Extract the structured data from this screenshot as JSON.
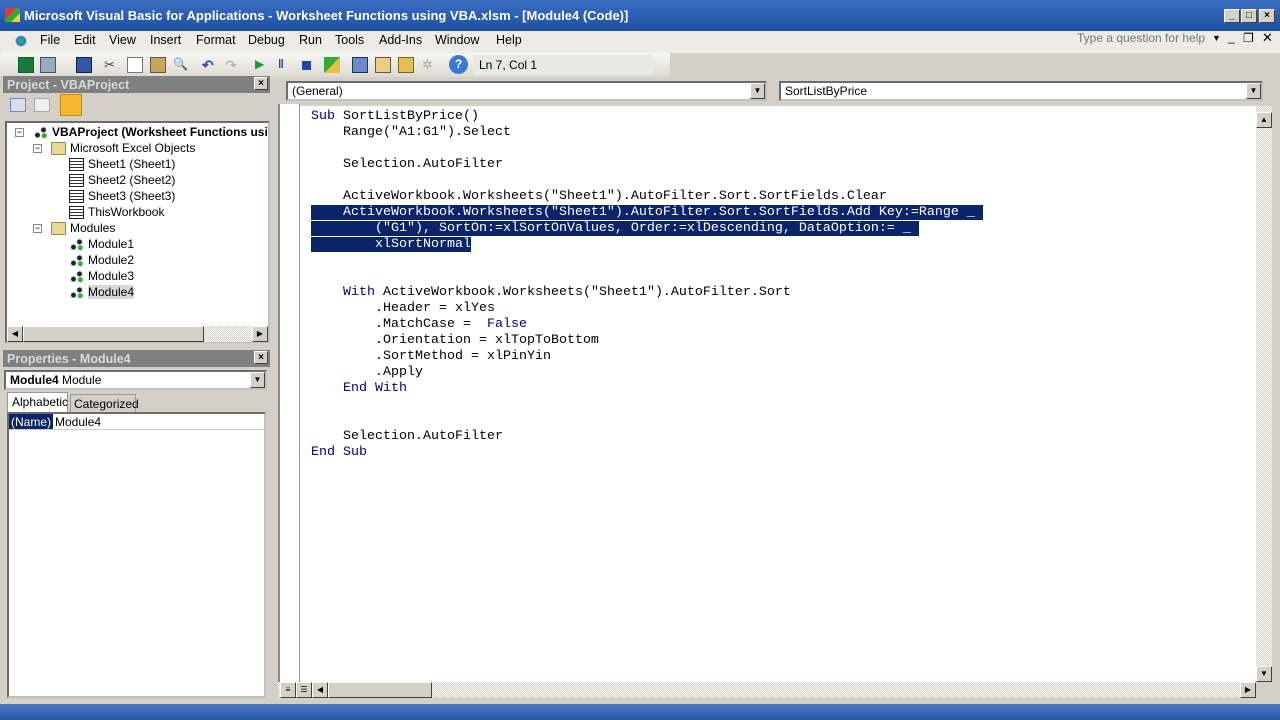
{
  "window": {
    "title": "Microsoft Visual Basic for Applications - Worksheet Functions using VBA.xlsm - [Module4 (Code)]"
  },
  "menu": [
    "File",
    "Edit",
    "View",
    "Insert",
    "Format",
    "Debug",
    "Run",
    "Tools",
    "Add-Ins",
    "Window",
    "Help"
  ],
  "help_placeholder": "Type a question for help",
  "toolbar": {
    "position": "Ln 7, Col 1",
    "icons": [
      "excel-icon",
      "insert-userform-icon",
      "save-icon",
      "cut-icon",
      "copy-icon",
      "paste-icon",
      "find-icon",
      "undo-icon",
      "redo-icon",
      "run-icon",
      "break-icon",
      "reset-icon",
      "design-mode-icon",
      "project-explorer-icon",
      "properties-icon",
      "object-browser-icon",
      "toolbox-icon",
      "help-icon"
    ]
  },
  "project": {
    "title": "Project - VBAProject",
    "tree": [
      {
        "label": "VBAProject (Worksheet Functions using VBA.xlsm)",
        "level": 0,
        "icon": "vba-project-icon",
        "bold": true
      },
      {
        "label": "Microsoft Excel Objects",
        "level": 1,
        "icon": "folder-icon"
      },
      {
        "label": "Sheet1 (Sheet1)",
        "level": 2,
        "icon": "sheet-icon"
      },
      {
        "label": "Sheet2 (Sheet2)",
        "level": 2,
        "icon": "sheet-icon"
      },
      {
        "label": "Sheet3 (Sheet3)",
        "level": 2,
        "icon": "sheet-icon"
      },
      {
        "label": "ThisWorkbook",
        "level": 2,
        "icon": "workbook-icon"
      },
      {
        "label": "Modules",
        "level": 1,
        "icon": "folder-icon"
      },
      {
        "label": "Module1",
        "level": 2,
        "icon": "module-icon"
      },
      {
        "label": "Module2",
        "level": 2,
        "icon": "module-icon"
      },
      {
        "label": "Module3",
        "level": 2,
        "icon": "module-icon"
      },
      {
        "label": "Module4",
        "level": 2,
        "icon": "module-icon",
        "selected": true
      }
    ]
  },
  "properties": {
    "title": "Properties - Module4",
    "object_name": "Module4",
    "object_type": "Module",
    "tabs": [
      "Alphabetic",
      "Categorized"
    ],
    "active_tab": "Alphabetic",
    "rows": [
      {
        "name": "(Name)",
        "value": "Module4"
      }
    ]
  },
  "code": {
    "object_combo": "(General)",
    "proc_combo": "SortListByPrice",
    "lines": [
      {
        "s": [
          [
            "kw",
            "Sub"
          ],
          [
            "",
            "SortListByPrice()"
          ]
        ]
      },
      {
        "s": [
          [
            "",
            "    Range(\"A1:G1\").Select"
          ]
        ]
      },
      {
        "s": []
      },
      {
        "s": [
          [
            "",
            "    Selection.AutoFilter"
          ]
        ]
      },
      {
        "s": []
      },
      {
        "s": [
          [
            "",
            "    ActiveWorkbook.Worksheets(\"Sheet1\").AutoFilter.Sort.SortFields.Clear"
          ]
        ]
      },
      {
        "s": [
          [
            "",
            "    ActiveWorkbook.Worksheets(\"Sheet1\").AutoFilter.Sort.SortFields.Add Key:=Range _ "
          ]
        ],
        "selected": true
      },
      {
        "s": [
          [
            "",
            "        (\"G1\"), SortOn:=xlSortOnValues, Order:=xlDescending, DataOption:= _ "
          ]
        ],
        "selected": true
      },
      {
        "s": [
          [
            "",
            "        xlSortNormal"
          ]
        ],
        "selected": true
      },
      {
        "s": []
      },
      {
        "s": []
      },
      {
        "s": [
          [
            "kw",
            "    With"
          ],
          [
            "",
            "ActiveWorkbook.Worksheets(\"Sheet1\").AutoFilter.Sort"
          ]
        ]
      },
      {
        "s": [
          [
            "",
            "        .Header = xlYes"
          ]
        ]
      },
      {
        "s": [
          [
            "",
            "        .MatchCase = "
          ],
          [
            "kw",
            "False"
          ]
        ]
      },
      {
        "s": [
          [
            "",
            "        .Orientation = xlTopToBottom"
          ]
        ]
      },
      {
        "s": [
          [
            "",
            "        .SortMethod = xlPinYin"
          ]
        ]
      },
      {
        "s": [
          [
            "",
            "        .Apply"
          ]
        ]
      },
      {
        "s": [
          [
            "kw",
            "    End With"
          ]
        ]
      },
      {
        "s": []
      },
      {
        "s": []
      },
      {
        "s": [
          [
            "",
            "    Selection.AutoFilter"
          ]
        ]
      },
      {
        "s": [
          [
            "kw",
            "End Sub"
          ]
        ]
      }
    ]
  }
}
